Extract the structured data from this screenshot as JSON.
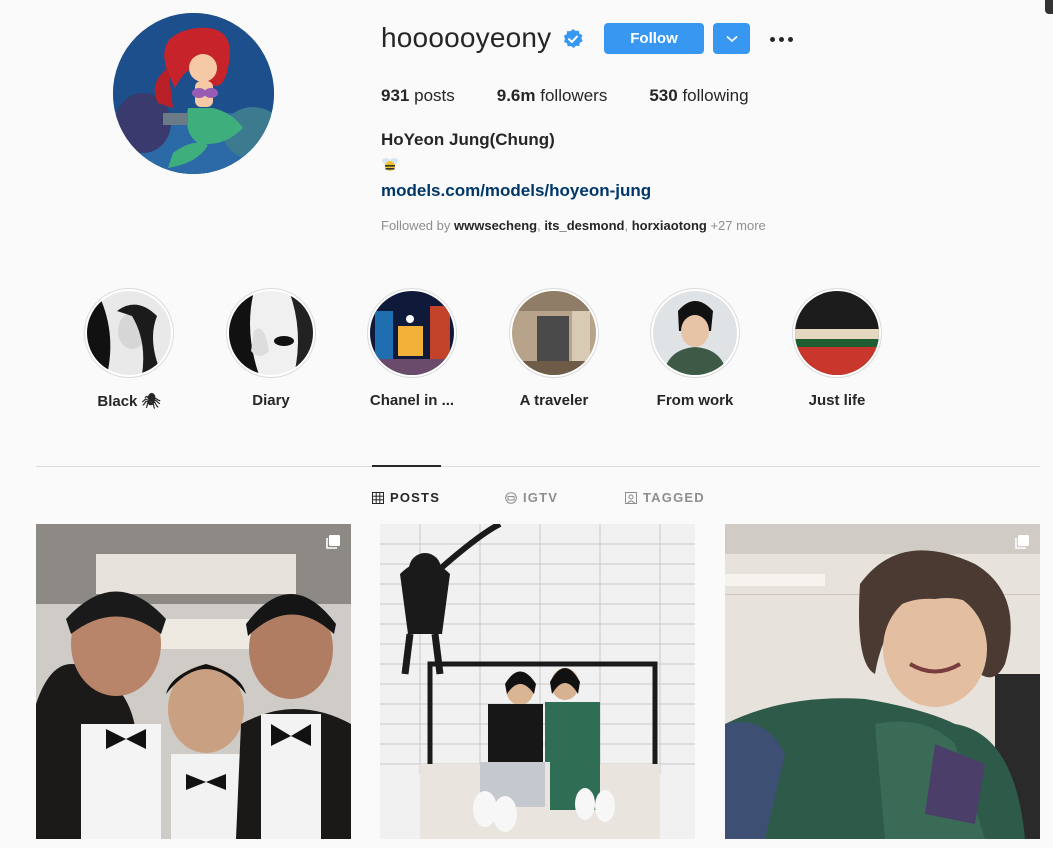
{
  "profile": {
    "username": "hoooooyeony",
    "verified": true,
    "follow_label": "Follow",
    "stats": {
      "posts": "931",
      "posts_label": "posts",
      "followers": "9.6m",
      "followers_label": "followers",
      "following": "530",
      "following_label": "following"
    },
    "full_name": "HoYeon Jung(Chung)",
    "bio_emoji": "bee-emoji",
    "link": "models.com/models/hoyeon-jung",
    "followed_by_prefix": "Followed by",
    "followed_by_users": [
      "wwwsecheng",
      "its_desmond",
      "horxiaotong"
    ],
    "followed_by_more": "+27 more"
  },
  "highlights": [
    {
      "label": "Black 🕷"
    },
    {
      "label": "Diary"
    },
    {
      "label": "Chanel in ..."
    },
    {
      "label": "A traveler"
    },
    {
      "label": "From work"
    },
    {
      "label": "Just life"
    }
  ],
  "tabs": [
    {
      "label": "POSTS",
      "icon": "grid-icon",
      "active": true
    },
    {
      "label": "IGTV",
      "icon": "igtv-icon",
      "active": false
    },
    {
      "label": "TAGGED",
      "icon": "tagged-icon",
      "active": false
    }
  ],
  "colors": {
    "accent": "#3897f0",
    "link": "#00376b",
    "muted": "#8e8e8e",
    "text": "#262626"
  }
}
